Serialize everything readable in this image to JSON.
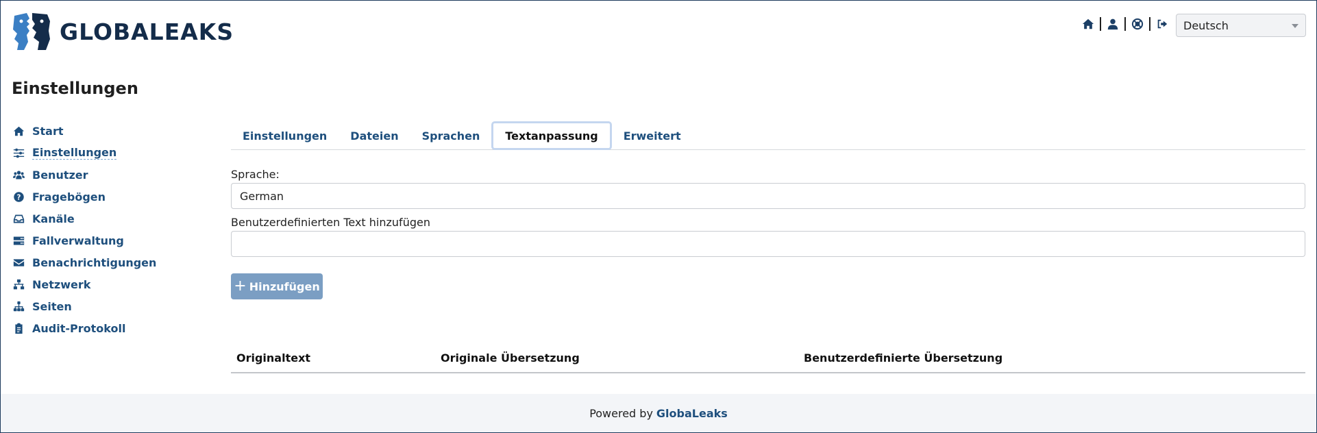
{
  "header": {
    "brand": "GLOBALEAKS",
    "icons": [
      "home-icon",
      "user-icon",
      "support-icon",
      "logout-icon"
    ],
    "language": "Deutsch"
  },
  "page": {
    "title": "Einstellungen"
  },
  "sidebar": {
    "items": [
      {
        "label": "Start",
        "icon": "home-icon"
      },
      {
        "label": "Einstellungen",
        "icon": "sliders-icon",
        "active": true
      },
      {
        "label": "Benutzer",
        "icon": "users-icon"
      },
      {
        "label": "Fragebögen",
        "icon": "question-icon"
      },
      {
        "label": "Kanäle",
        "icon": "inbox-icon"
      },
      {
        "label": "Fallverwaltung",
        "icon": "server-icon"
      },
      {
        "label": "Benachrichtigungen",
        "icon": "envelope-icon"
      },
      {
        "label": "Netzwerk",
        "icon": "network-icon"
      },
      {
        "label": "Seiten",
        "icon": "sitemap-icon"
      },
      {
        "label": "Audit-Protokoll",
        "icon": "clipboard-icon"
      }
    ]
  },
  "tabs": [
    {
      "label": "Einstellungen"
    },
    {
      "label": "Dateien"
    },
    {
      "label": "Sprachen"
    },
    {
      "label": "Textanpassung",
      "active": true
    },
    {
      "label": "Erweitert"
    }
  ],
  "form": {
    "language_label": "Sprache:",
    "language_value": "German",
    "custom_text_label": "Benutzerdefinierten Text hinzufügen",
    "custom_text_value": "",
    "add_button": "Hinzufügen"
  },
  "table": {
    "columns": [
      "Originaltext",
      "Originale Übersetzung",
      "Benutzerdefinierte Übersetzung"
    ]
  },
  "footer": {
    "prefix": "Powered by",
    "link": "GlobaLeaks"
  },
  "colors": {
    "brand_dark": "#142c4a",
    "link": "#1e4f7d",
    "logo_blue": "#3b7fc4",
    "button": "#7b9ec3",
    "active_tab_border": "#c4d6ef",
    "footer_bg": "#f3f5f8"
  }
}
